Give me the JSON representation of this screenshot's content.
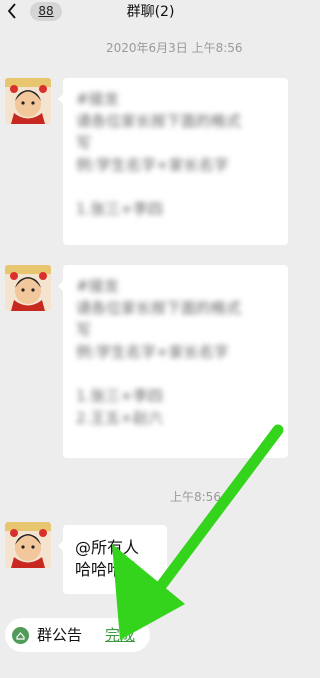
{
  "header": {
    "back_icon": "chevron-left-icon",
    "unread_count": "88",
    "title": "群聊(2)"
  },
  "chat": {
    "date_separator": "2020年6月3日 上午8:56",
    "time_separator_2": "上午8:56",
    "messages": [
      {
        "sender": "avatar",
        "blurred": true,
        "lines": [
          "#接龙",
          "请各位家长按下面的格式",
          "写",
          "例:学生名字+家长名字",
          "",
          "1.张三+李四"
        ]
      },
      {
        "sender": "avatar",
        "blurred": true,
        "lines": [
          "#接龙",
          "请各位家长按下面的格式",
          "写",
          "例:学生名字+家长名字",
          "",
          "1.张三+李四",
          "2.王五+赵六"
        ]
      },
      {
        "sender": "avatar",
        "blurred": false,
        "lines": [
          "@所有人",
          "哈哈哈哈"
        ]
      }
    ]
  },
  "footer": {
    "notice_icon": "group-notice-icon",
    "notice_label": "群公告",
    "done_label": "完成"
  },
  "colors": {
    "background": "#ededed",
    "bubble": "#ffffff",
    "done_link": "#3c9a3f",
    "annotation_arrow": "#35d41c"
  }
}
